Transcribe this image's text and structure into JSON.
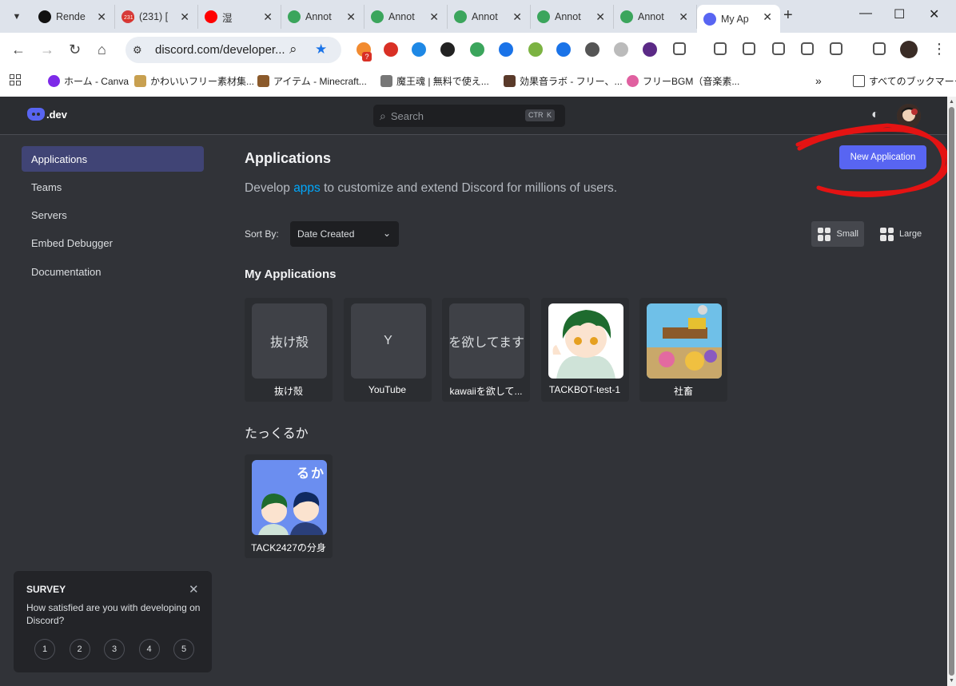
{
  "browser": {
    "tabs": [
      {
        "title": "Rende",
        "favicon_color": "#111111"
      },
      {
        "title": "(231) [",
        "favicon_color": "#d63b3b"
      },
      {
        "title": "湿",
        "favicon_color": "#ff0000"
      },
      {
        "title": "Annot",
        "favicon_color": "#3ba55c"
      },
      {
        "title": "Annot",
        "favicon_color": "#3ba55c"
      },
      {
        "title": "Annot",
        "favicon_color": "#3ba55c"
      },
      {
        "title": "Annot",
        "favicon_color": "#3ba55c"
      },
      {
        "title": "Annot",
        "favicon_color": "#3ba55c"
      },
      {
        "title": "My Ap",
        "favicon_color": "#5865f2"
      }
    ],
    "tab_badge": "231",
    "url": "discord.com/developer...",
    "bookmarks": [
      {
        "label": "ホーム - Canva",
        "color": "#7d2ae8"
      },
      {
        "label": "かわいいフリー素材集...",
        "color": "#c8a050"
      },
      {
        "label": "アイテム - Minecraft...",
        "color": "#8b5a2b"
      },
      {
        "label": "魔王魂 | 無料で使え...",
        "color": "#777777"
      },
      {
        "label": "効果音ラボ - フリー、...",
        "color": "#5a3a2a"
      },
      {
        "label": "フリーBGM（音楽素...",
        "color": "#e060a0"
      }
    ],
    "bookmarks_all": "すべてのブックマーク",
    "ext_badge": "?"
  },
  "portal": {
    "logo_text": ".dev",
    "search_placeholder": "Search",
    "kbd_ctrl": "CTRL",
    "kbd_k": "K",
    "sidebar": [
      {
        "label": "Applications",
        "active": true
      },
      {
        "label": "Teams",
        "active": false
      },
      {
        "label": "Servers",
        "active": false
      },
      {
        "label": "Embed Debugger",
        "active": false
      },
      {
        "label": "Documentation",
        "active": false
      }
    ],
    "title": "Applications",
    "subtitle_pre": "Develop ",
    "subtitle_link": "apps",
    "subtitle_post": " to customize and extend Discord for millions of users.",
    "new_app_label": "New Application",
    "sort_label": "Sort By:",
    "sort_value": "Date Created",
    "view_small": "Small",
    "view_large": "Large",
    "section_my_apps": "My Applications",
    "my_apps": [
      {
        "thumb_text": "抜け殻",
        "name": "抜け殻"
      },
      {
        "thumb_text": "Y",
        "name": "YouTube"
      },
      {
        "thumb_text": "kawaiiを欲してます",
        "name": "kawaiiを欲して..."
      },
      {
        "thumb_text": "",
        "name": "TACKBOT-test-1"
      },
      {
        "thumb_text": "",
        "name": "社畜"
      }
    ],
    "section_team": "たっくるか",
    "team_apps": [
      {
        "thumb_text": "る か",
        "name": "TACK2427の分身"
      }
    ],
    "survey": {
      "title": "SURVEY",
      "question": "How satisfied are you with developing on Discord?",
      "ratings": [
        "1",
        "2",
        "3",
        "4",
        "5"
      ]
    }
  }
}
